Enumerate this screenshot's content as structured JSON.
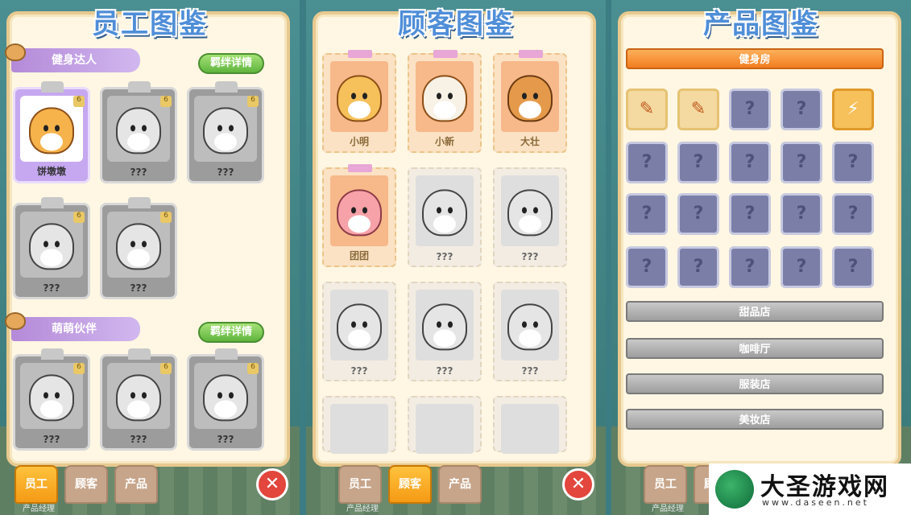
{
  "panels": {
    "employees": {
      "title": "员工图鉴",
      "groups": [
        {
          "header": "健身达人",
          "bond_button": "羁绊详情",
          "cards": [
            {
              "name": "饼墩墩",
              "unlocked": true
            },
            {
              "name": "???",
              "unlocked": false
            },
            {
              "name": "???",
              "unlocked": false
            },
            {
              "name": "???",
              "unlocked": false
            },
            {
              "name": "???",
              "unlocked": false
            }
          ]
        },
        {
          "header": "萌萌伙伴",
          "bond_button": "羁绊详情",
          "cards": [
            {
              "name": "???",
              "unlocked": false
            },
            {
              "name": "???",
              "unlocked": false
            },
            {
              "name": "???",
              "unlocked": false
            }
          ]
        }
      ]
    },
    "customers": {
      "title": "顾客图鉴",
      "cards": [
        {
          "name": "小明",
          "unlocked": true
        },
        {
          "name": "小新",
          "unlocked": true
        },
        {
          "name": "大壮",
          "unlocked": true
        },
        {
          "name": "团团",
          "unlocked": true
        },
        {
          "name": "???",
          "unlocked": false
        },
        {
          "name": "???",
          "unlocked": false
        },
        {
          "name": "???",
          "unlocked": false
        },
        {
          "name": "???",
          "unlocked": false
        },
        {
          "name": "???",
          "unlocked": false
        },
        {
          "name": "",
          "unlocked": false
        },
        {
          "name": "",
          "unlocked": false
        },
        {
          "name": "",
          "unlocked": false
        }
      ]
    },
    "products": {
      "title": "产品图鉴",
      "sections": [
        {
          "label": "健身房",
          "active": true
        },
        {
          "label": "甜品店",
          "active": false
        },
        {
          "label": "咖啡厅",
          "active": false
        },
        {
          "label": "服装店",
          "active": false
        },
        {
          "label": "美妆店",
          "active": false
        }
      ],
      "tile_unknown": "?",
      "tile_bolt": "⚡",
      "tile_paper": "✎"
    }
  },
  "tabs": {
    "employees": "员工",
    "customers": "顾客",
    "products": "产品"
  },
  "sub_label": "产品经理",
  "close_symbol": "✕",
  "watermark": {
    "brand": "大圣游戏网",
    "url": "www.daseen.net"
  }
}
